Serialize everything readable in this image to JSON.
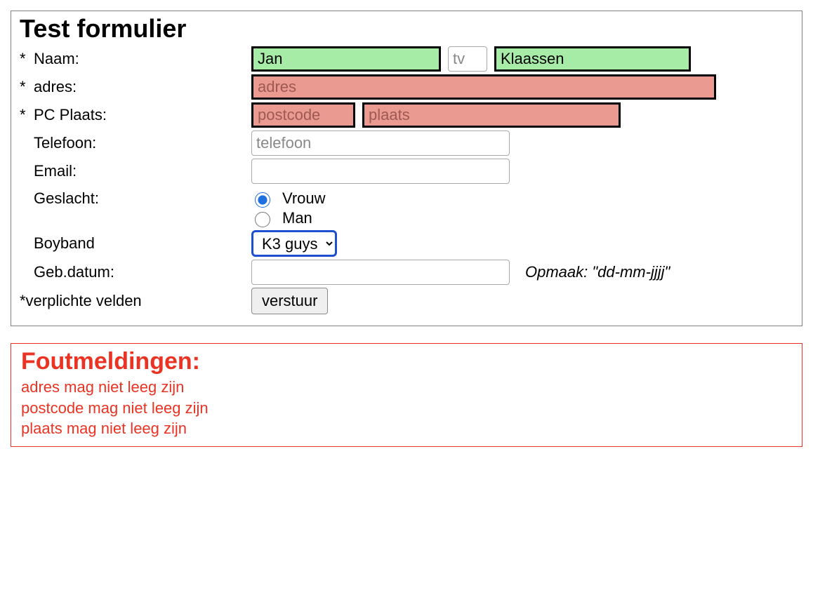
{
  "form": {
    "title": "Test formulier",
    "rows": {
      "naam": {
        "label": "Naam:",
        "required": true,
        "first_value": "Jan",
        "tv_placeholder": "tv",
        "last_value": "Klaassen"
      },
      "adres": {
        "label": "adres:",
        "required": true,
        "placeholder": "adres"
      },
      "pcplaats": {
        "label": "PC Plaats:",
        "required": true,
        "postcode_placeholder": "postcode",
        "plaats_placeholder": "plaats"
      },
      "telefoon": {
        "label": "Telefoon:",
        "placeholder": "telefoon"
      },
      "email": {
        "label": "Email:"
      },
      "geslacht": {
        "label": "Geslacht:",
        "options": {
          "vrouw": "Vrouw",
          "man": "Man"
        },
        "selected": "vrouw"
      },
      "boyband": {
        "label": "Boyband",
        "selected": "K3 guys"
      },
      "gebdatum": {
        "label": "Geb.datum:",
        "hint": "Opmaak: \"dd-mm-jjjj\""
      },
      "footer": {
        "required_note": "*verplichte velden",
        "submit_label": "verstuur"
      }
    }
  },
  "errors": {
    "title": "Foutmeldingen:",
    "messages": [
      "adres mag niet leeg zijn",
      "postcode mag niet leeg zijn",
      "plaats mag niet leeg zijn"
    ]
  }
}
